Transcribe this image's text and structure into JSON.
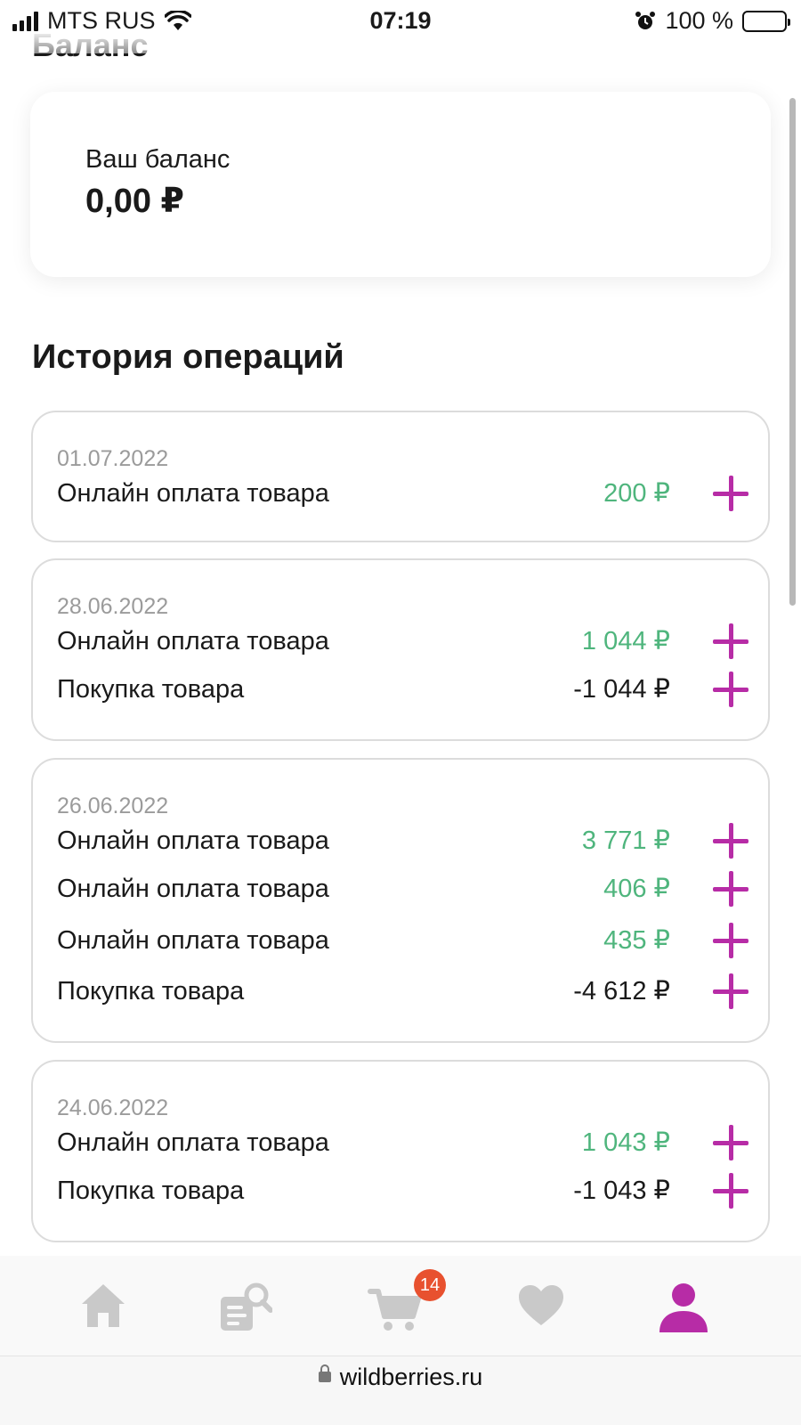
{
  "status_bar": {
    "carrier": "MTS RUS",
    "time": "07:19",
    "battery": "100 %"
  },
  "page": {
    "title": "Баланс"
  },
  "balance": {
    "label": "Ваш баланс",
    "value": "0,00 ₽"
  },
  "history": {
    "title": "История операций",
    "groups": [
      {
        "date": "01.07.2022",
        "items": [
          {
            "name": "Онлайн оплата товара",
            "amount": "200 ₽"
          }
        ]
      },
      {
        "date": "28.06.2022",
        "items": [
          {
            "name": "Онлайн оплата товара",
            "amount": "1 044 ₽"
          },
          {
            "name": "Покупка товара",
            "amount": "-1 044 ₽"
          }
        ]
      },
      {
        "date": "26.06.2022",
        "items": [
          {
            "name": "Онлайн оплата товара",
            "amount": "3 771 ₽"
          },
          {
            "name": "Онлайн оплата товара",
            "amount": "406 ₽"
          },
          {
            "name": "Онлайн оплата товара",
            "amount": "435 ₽"
          },
          {
            "name": "Покупка товара",
            "amount": "-4 612 ₽"
          }
        ]
      },
      {
        "date": "24.06.2022",
        "items": [
          {
            "name": "Онлайн оплата товара",
            "amount": "1 043 ₽"
          },
          {
            "name": "Покупка товара",
            "amount": "-1 043 ₽"
          }
        ]
      }
    ]
  },
  "bottom_nav": {
    "items": [
      {
        "icon": "home-icon"
      },
      {
        "icon": "catalog-search-icon"
      },
      {
        "icon": "cart-icon",
        "badge": "14"
      },
      {
        "icon": "heart-icon"
      },
      {
        "icon": "profile-icon",
        "active": true
      }
    ]
  },
  "browser": {
    "url": "wildberries.ru"
  },
  "colors": {
    "accent": "#b72ca6",
    "positive": "#4fb57d",
    "badge": "#e8512f",
    "inactive_icon": "#c9c9c9"
  }
}
